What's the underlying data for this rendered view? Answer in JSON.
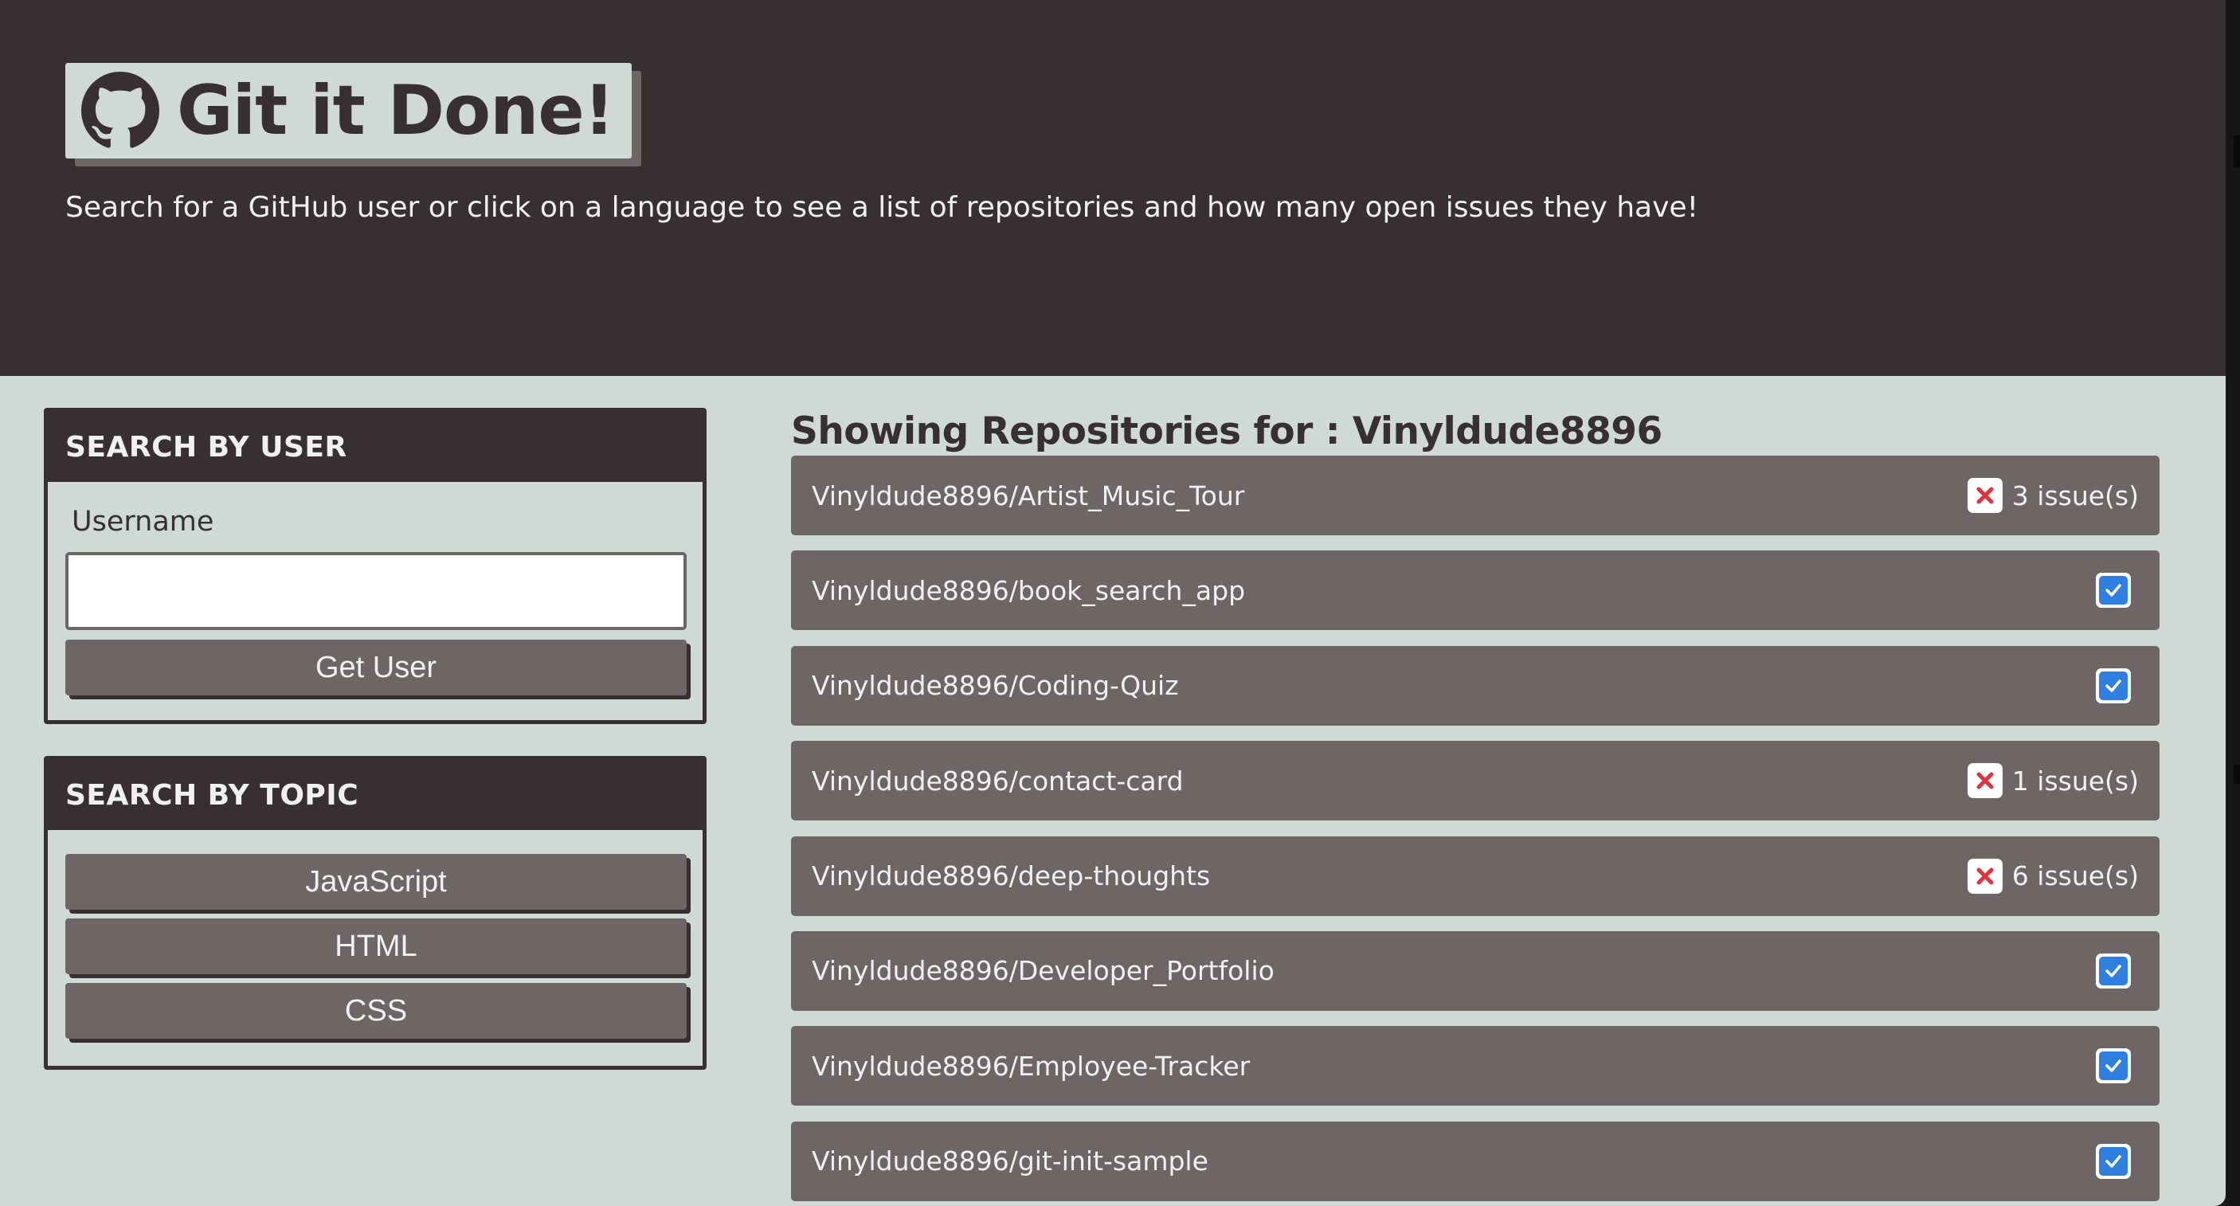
{
  "header": {
    "title": "Git it Done!",
    "tagline": "Search for a GitHub user or click on a language to see a list of repositories and how many open issues they have!",
    "logo_icon": "github-icon"
  },
  "user_search": {
    "heading": "SEARCH BY USER",
    "label": "Username",
    "value": "",
    "button_label": "Get User"
  },
  "topic_search": {
    "heading": "SEARCH BY TOPIC",
    "topics": [
      "JavaScript",
      "HTML",
      "CSS"
    ]
  },
  "repos": {
    "heading": "Showing Repositories for : Vinyldude8896",
    "items": [
      {
        "name": "Vinyldude8896/Artist_Music_Tour",
        "issues": "3 issue(s)",
        "status": "x-icon"
      },
      {
        "name": "Vinyldude8896/book_search_app",
        "issues": "",
        "status": "check-icon"
      },
      {
        "name": "Vinyldude8896/Coding-Quiz",
        "issues": "",
        "status": "check-icon"
      },
      {
        "name": "Vinyldude8896/contact-card",
        "issues": "1 issue(s)",
        "status": "x-icon"
      },
      {
        "name": "Vinyldude8896/deep-thoughts",
        "issues": "6 issue(s)",
        "status": "x-icon"
      },
      {
        "name": "Vinyldude8896/Developer_Portfolio",
        "issues": "",
        "status": "check-icon"
      },
      {
        "name": "Vinyldude8896/Employee-Tracker",
        "issues": "",
        "status": "check-icon"
      },
      {
        "name": "Vinyldude8896/git-init-sample",
        "issues": "",
        "status": "check-icon"
      }
    ]
  },
  "colors": {
    "dark": "#383030",
    "mid": "#6e6664",
    "light": "#cfdad4",
    "text_light": "#f0f2f0",
    "danger": "#e0333b",
    "success": "#2f7fe0"
  }
}
